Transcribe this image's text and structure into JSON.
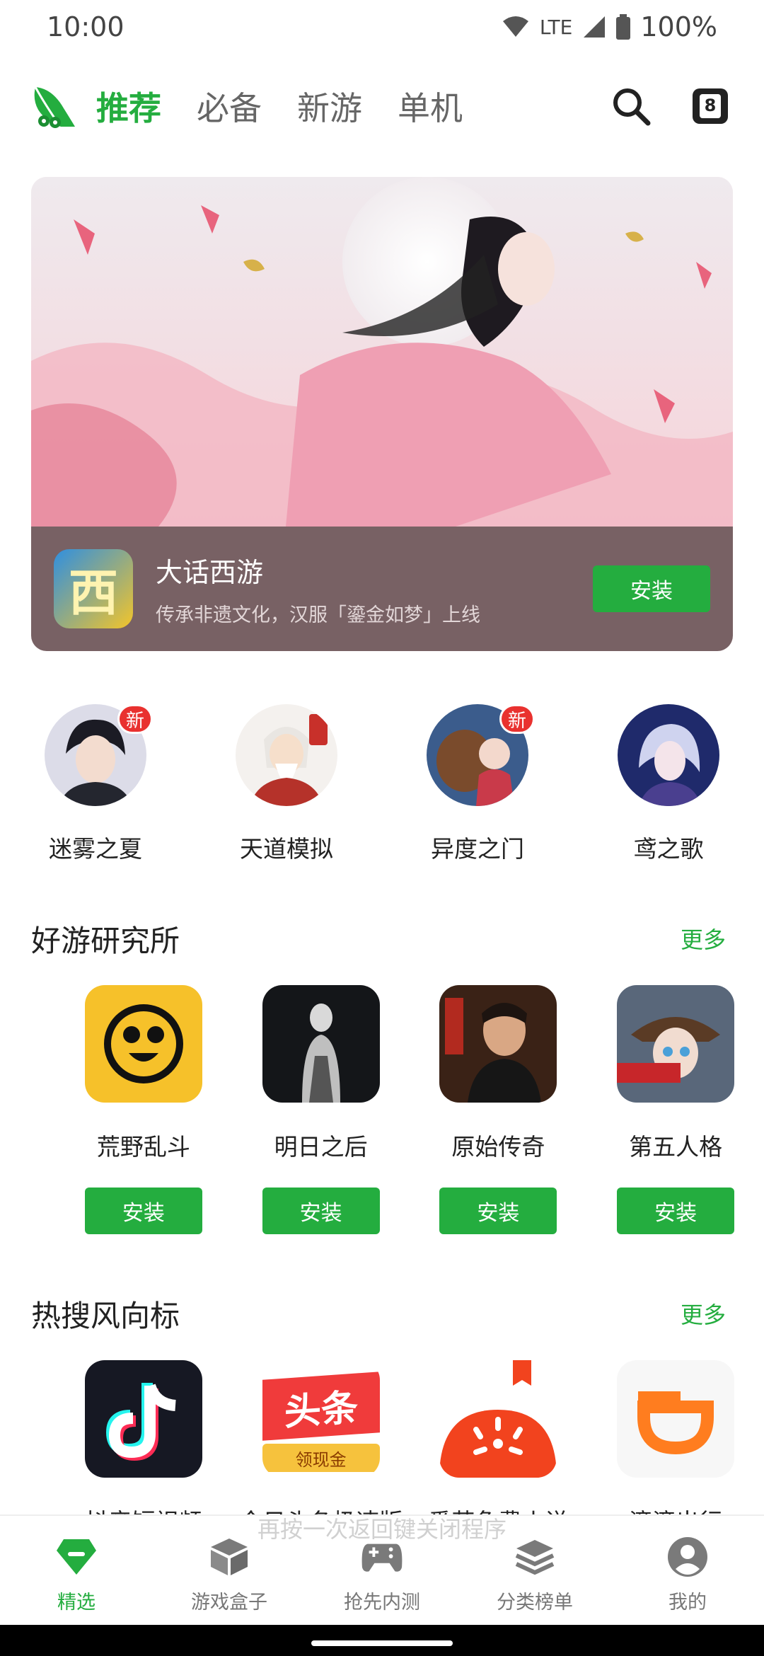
{
  "status": {
    "time": "10:00",
    "network": "LTE",
    "battery": "100%"
  },
  "nav": {
    "tabs": [
      {
        "label": "推荐"
      },
      {
        "label": "必备"
      },
      {
        "label": "新游"
      },
      {
        "label": "单机"
      }
    ],
    "badge": "8"
  },
  "banner": {
    "title": "大话西游",
    "subtitle": "传承非遗文化，汉服「鎏金如梦」上线",
    "install": "安装",
    "icon_glyph": "西"
  },
  "circles": [
    {
      "label": "迷雾之夏",
      "badge": "新"
    },
    {
      "label": "天道模拟",
      "badge": ""
    },
    {
      "label": "异度之门",
      "badge": "新"
    },
    {
      "label": "鸢之歌",
      "badge": ""
    }
  ],
  "section1": {
    "title": "好游研究所",
    "more": "更多",
    "apps": [
      {
        "name": "荒野乱斗",
        "install": "安装"
      },
      {
        "name": "明日之后",
        "install": "安装"
      },
      {
        "name": "原始传奇",
        "install": "安装"
      },
      {
        "name": "第五人格",
        "install": "安装"
      }
    ]
  },
  "section2": {
    "title": "热搜风向标",
    "more": "更多",
    "apps": [
      {
        "name": "抖音短视频"
      },
      {
        "name": "今日头条极速版",
        "icon_text": "头条",
        "icon_sub": "领现金"
      },
      {
        "name": "番茄免费小说"
      },
      {
        "name": "滴滴出行"
      }
    ]
  },
  "toast": "再按一次返回键关闭程序",
  "bottom_nav": [
    {
      "label": "精选"
    },
    {
      "label": "游戏盒子"
    },
    {
      "label": "抢先内测"
    },
    {
      "label": "分类榜单"
    },
    {
      "label": "我的"
    }
  ],
  "colors": {
    "accent": "#24ad3f",
    "banner_bar": "#786164",
    "badge_red": "#e9312f"
  }
}
